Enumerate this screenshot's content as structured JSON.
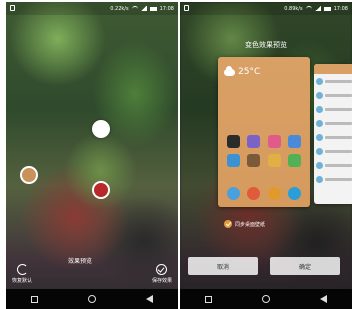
{
  "left_phone": {
    "status": {
      "speed": "0.22k/s",
      "time": "17:08"
    },
    "preview_label": "效果预览",
    "tools": [
      {
        "icon": "refresh-icon",
        "label": "恢复默认"
      },
      {
        "icon": "check-icon",
        "label": "保存效果"
      }
    ],
    "picker_colors": [
      "#ffffff",
      "#c9915c",
      "#b9282a"
    ]
  },
  "right_phone": {
    "status": {
      "speed": "0.89k/s",
      "time": "17:08"
    },
    "dialog_title": "变色效果预览",
    "weather": {
      "temperature": "25°C",
      "icon": "cloud-icon"
    },
    "app_colors": [
      "#2b2b2b",
      "#7b62c9",
      "#e05b8a",
      "#4a8ad8",
      "#3b91d1",
      "#7b5a3a",
      "#e0b044",
      "#52b154",
      "#4aa0dc",
      "#e05b3b",
      "#e09a2b",
      "#2a9ed8"
    ],
    "sync_label": "同步桌面壁纸",
    "cancel_label": "取消",
    "confirm_label": "确定",
    "theme_color": "#d9a066"
  }
}
